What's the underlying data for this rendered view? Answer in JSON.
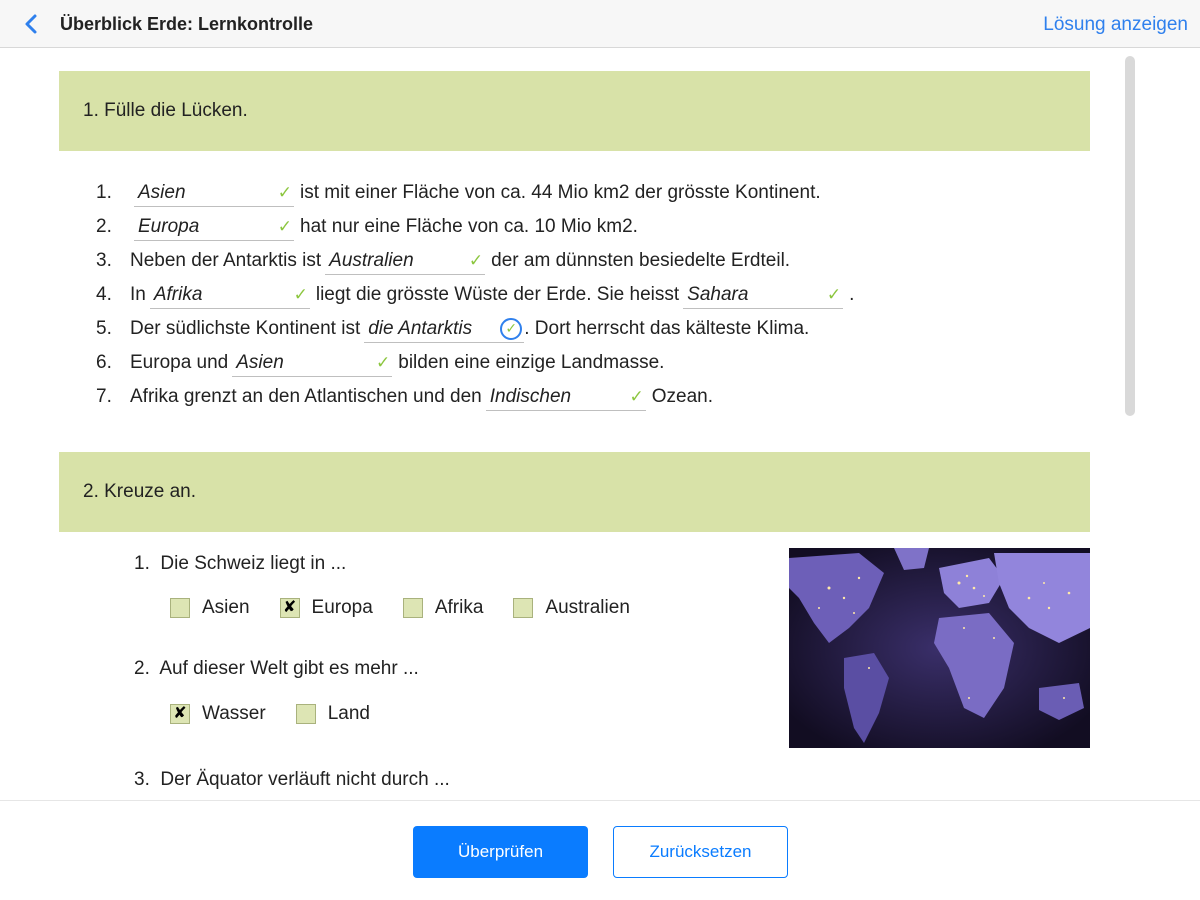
{
  "header": {
    "title": "Überblick Erde: Lernkontrolle",
    "solution_link": "Lösung anzeigen",
    "back_icon": "chevron-left-icon"
  },
  "section1": {
    "title": "1. Fülle die Lücken.",
    "rows": [
      {
        "num": "1.",
        "pre": "",
        "blank": "Asien",
        "post": "ist mit einer Fläche von ca. 44 Mio km2 der grösste Kontinent."
      },
      {
        "num": "2.",
        "pre": "",
        "blank": "Europa",
        "post": "hat nur eine Fläche von ca. 10 Mio km2."
      },
      {
        "num": "3.",
        "pre": "Neben der Antarktis ist",
        "blank": "Australien",
        "post": "der am dünnsten besiedelte Erdteil."
      },
      {
        "num": "4.",
        "pre": "In",
        "blank": "Afrika",
        "mid": "liegt die grösste Wüste der Erde. Sie heisst",
        "blank2": "Sahara",
        "post": "."
      },
      {
        "num": "5.",
        "pre": "Der südlichste Kontinent ist",
        "blank": "die Antarktis",
        "post": ". Dort herrscht das kälteste Klima."
      },
      {
        "num": "6.",
        "pre": "Europa und",
        "blank": "Asien",
        "post": "bilden eine einzige Landmasse."
      },
      {
        "num": "7.",
        "pre": "Afrika grenzt an den Atlantischen und den",
        "blank": "Indischen",
        "post": "Ozean."
      }
    ],
    "check_mark": "✓"
  },
  "section2": {
    "title": "2. Kreuze an.",
    "questions": [
      {
        "num": "1.",
        "text": "Die Schweiz liegt in ...",
        "options": [
          {
            "label": "Asien",
            "checked": ""
          },
          {
            "label": "Europa",
            "checked": "✘"
          },
          {
            "label": "Afrika",
            "checked": ""
          },
          {
            "label": "Australien",
            "checked": ""
          }
        ]
      },
      {
        "num": "2.",
        "text": "Auf dieser Welt gibt es mehr ...",
        "options": [
          {
            "label": "Wasser",
            "checked": "✘"
          },
          {
            "label": "Land",
            "checked": ""
          }
        ]
      },
      {
        "num": "3.",
        "text": "Der Äquator verläuft nicht durch ..."
      }
    ],
    "image_icon": "world-night-map-image"
  },
  "footer": {
    "check_button": "Überprüfen",
    "reset_button": "Zurücksetzen"
  },
  "colors": {
    "accent": "#0a7cff",
    "section_bg": "#d8e2a8",
    "check_green": "#8cc63f"
  }
}
